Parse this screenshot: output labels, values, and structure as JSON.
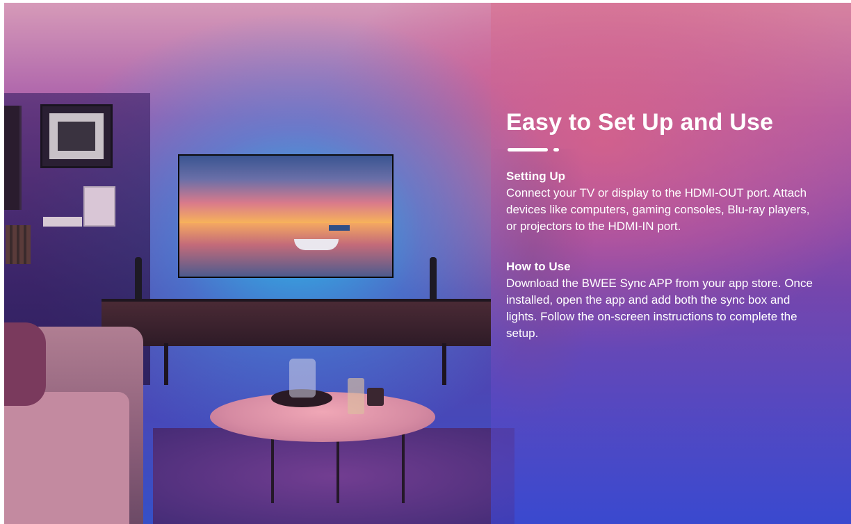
{
  "banner": {
    "title": "Easy to Set Up and Use",
    "sections": [
      {
        "heading": "Setting Up",
        "body": "Connect your TV or display to the HDMI-OUT port. Attach devices like computers, gaming consoles, Blu-ray players, or projectors to the HDMI-IN port."
      },
      {
        "heading": "How to Use",
        "body": "Download the BWEE Sync APP from your app store. Once installed, open the app and add both the sync box and lights. Follow the on-screen instructions to complete the setup."
      }
    ],
    "colors": {
      "text": "#ffffff",
      "accent_top": "#d69ab8",
      "accent_mid": "#e2647e",
      "accent_bottom": "#3550c8",
      "backlight": "#2bb7e8"
    }
  }
}
